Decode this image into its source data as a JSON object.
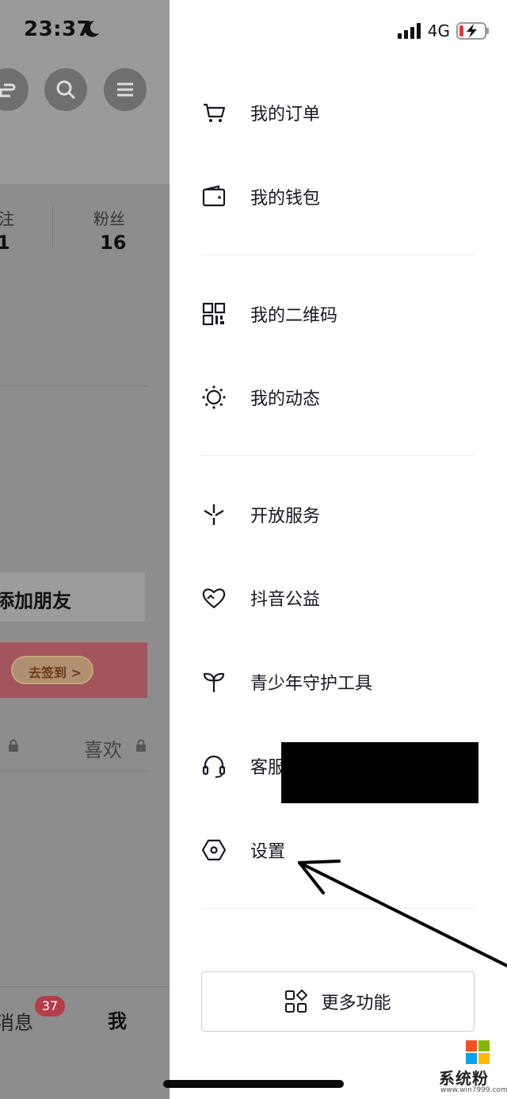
{
  "status_bar": {
    "time": "23:37",
    "network": "4G"
  },
  "background": {
    "stats": [
      {
        "label": "注",
        "value": "1"
      },
      {
        "label": "粉丝",
        "value": "16"
      }
    ],
    "add_friend": "添加朋友",
    "checkin_button": "去签到 >",
    "tab_like": "喜欢",
    "nav_messages": "消息",
    "nav_messages_badge": "37",
    "nav_me": "我"
  },
  "drawer": {
    "items": [
      {
        "label": "我的订单",
        "icon": "cart-icon"
      },
      {
        "label": "我的钱包",
        "icon": "wallet-icon"
      },
      {
        "label": "我的二维码",
        "icon": "qr-code-icon"
      },
      {
        "label": "我的动态",
        "icon": "moments-icon"
      },
      {
        "label": "开放服务",
        "icon": "open-service-icon"
      },
      {
        "label": "抖音公益",
        "icon": "charity-heart-icon"
      },
      {
        "label": "青少年守护工具",
        "icon": "sprout-icon"
      },
      {
        "label": "客服",
        "icon": "headset-icon"
      },
      {
        "label": "设置",
        "icon": "settings-hexagon-icon"
      }
    ],
    "more_button": "更多功能"
  },
  "watermark": {
    "text": "系统粉",
    "url": "www.win7999.com"
  }
}
